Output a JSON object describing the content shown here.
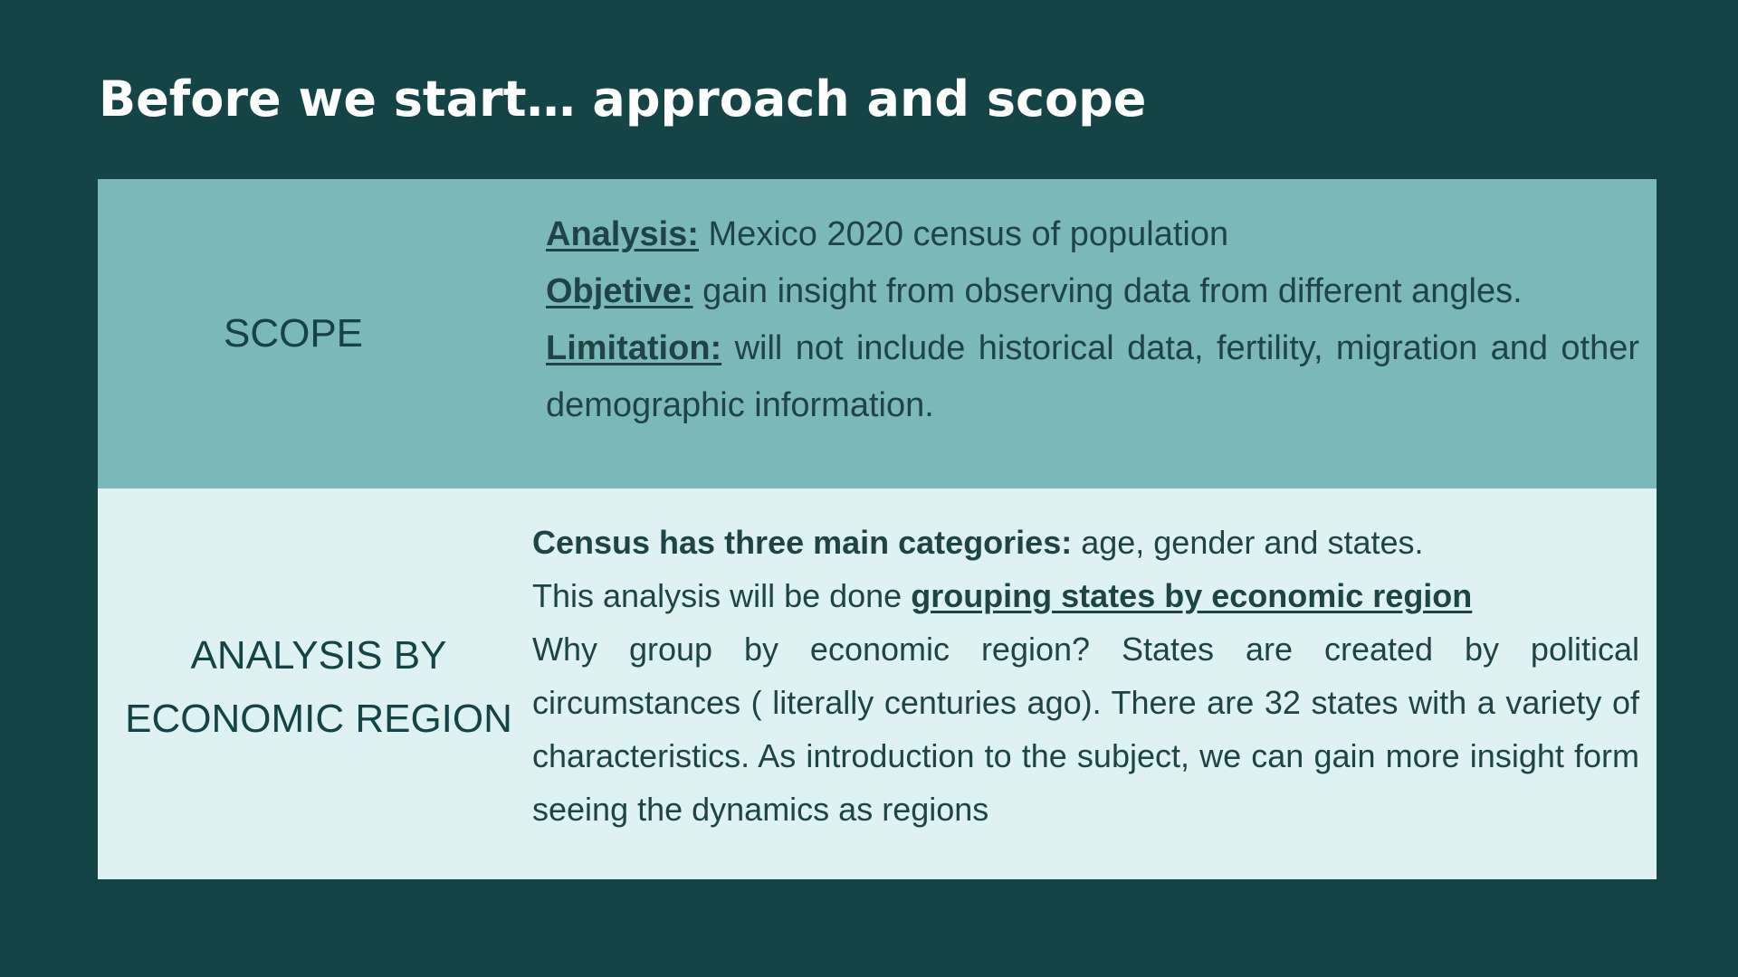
{
  "title": "Before we start… approach and scope",
  "colors": {
    "background": "#154446",
    "scope_row_bg": "#7bb8b8",
    "econ_row_bg": "#def2f3",
    "text_dark": "#154446",
    "title_text": "#ffffff"
  },
  "rows": [
    {
      "label": "SCOPE",
      "items": [
        {
          "label": "Analysis:",
          "text": " Mexico 2020 census of population"
        },
        {
          "label": "Objetive:",
          "text": " gain insight  from observing data from different angles."
        },
        {
          "label": "Limitation:",
          "text": " will not include historical data, fertility, migration and other demographic information."
        }
      ]
    },
    {
      "label_line1": "ANALYSIS BY",
      "label_line2": "ECONOMIC REGION",
      "line1_bold": "Census has three main categories:",
      "line1_text": " age, gender and states.",
      "line2_text": "This analysis will be done ",
      "line2_link": "grouping states by economic region",
      "paragraph": "Why group by economic region? States are created by political circumstances ( literally centuries ago). There are 32 states with a variety of characteristics. As introduction to the subject, we can gain more insight form seeing the dynamics as regions"
    }
  ]
}
